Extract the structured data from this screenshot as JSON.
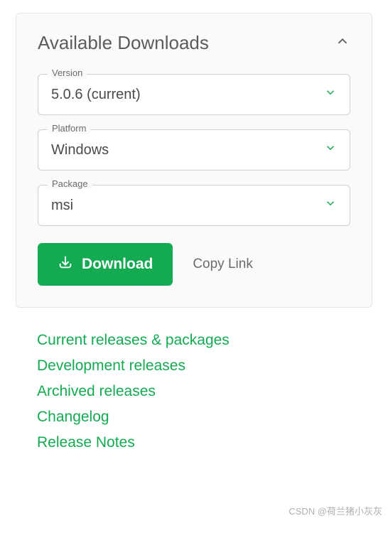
{
  "panel": {
    "title": "Available Downloads",
    "fields": {
      "version": {
        "label": "Version",
        "value": "5.0.6 (current)"
      },
      "platform": {
        "label": "Platform",
        "value": "Windows"
      },
      "package": {
        "label": "Package",
        "value": "msi"
      }
    },
    "actions": {
      "download": "Download",
      "copyLink": "Copy Link"
    }
  },
  "links": [
    "Current releases & packages",
    "Development releases",
    "Archived releases",
    "Changelog",
    "Release Notes"
  ],
  "watermark": "CSDN @荷兰猪小灰灰"
}
